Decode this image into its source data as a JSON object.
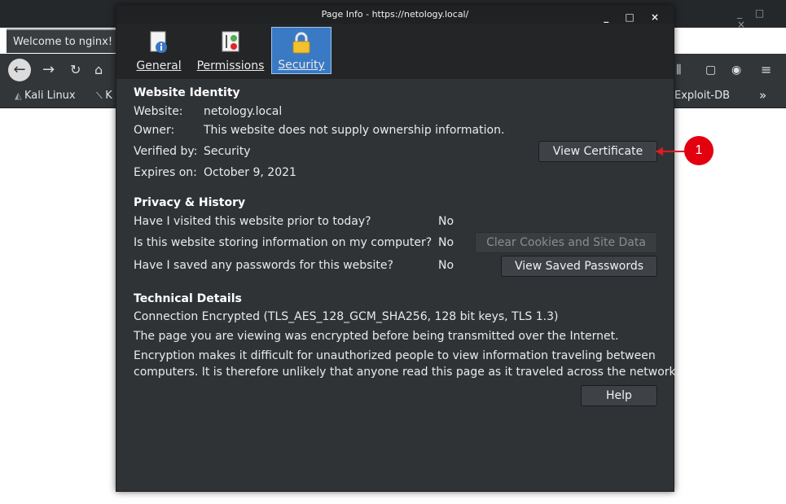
{
  "browser": {
    "tab_title": "Welcome to nginx!",
    "bookmarks": [
      "Kali Linux",
      "K",
      "Exploit-DB"
    ],
    "window_controls": "_ □ ×"
  },
  "dialog": {
    "title": "Page Info - https://netology.local/",
    "window_controls": "_ □ ×",
    "tabs": [
      {
        "label": "General",
        "icon": "info-icon"
      },
      {
        "label": "Permissions",
        "icon": "permissions-icon"
      },
      {
        "label": "Security",
        "icon": "lock-icon",
        "active": true
      }
    ],
    "identity": {
      "heading": "Website Identity",
      "website_label": "Website:",
      "website_value": "netology.local",
      "owner_label": "Owner:",
      "owner_value": "This website does not supply ownership information.",
      "verified_label": "Verified by:",
      "verified_value": "Security",
      "expires_label": "Expires on:",
      "expires_value": "October 9, 2021",
      "view_certificate": "View Certificate"
    },
    "privacy": {
      "heading": "Privacy & History",
      "q1": "Have I visited this website prior to today?",
      "a1": "No",
      "q2": "Is this website storing information on my computer?",
      "a2": "No",
      "q3": "Have I saved any passwords for this website?",
      "a3": "No",
      "clear_cookies": "Clear Cookies and Site Data",
      "view_passwords": "View Saved Passwords"
    },
    "technical": {
      "heading": "Technical Details",
      "line1": "Connection Encrypted (TLS_AES_128_GCM_SHA256, 128 bit keys, TLS 1.3)",
      "line2": "The page you are viewing was encrypted before being transmitted over the Internet.",
      "line3": "Encryption makes it difficult for unauthorized people to view information traveling between",
      "line4": "computers. It is therefore unlikely that anyone read this page as it traveled across the network.",
      "help": "Help"
    }
  },
  "annotation": {
    "number": "1",
    "color": "#e3000f"
  }
}
